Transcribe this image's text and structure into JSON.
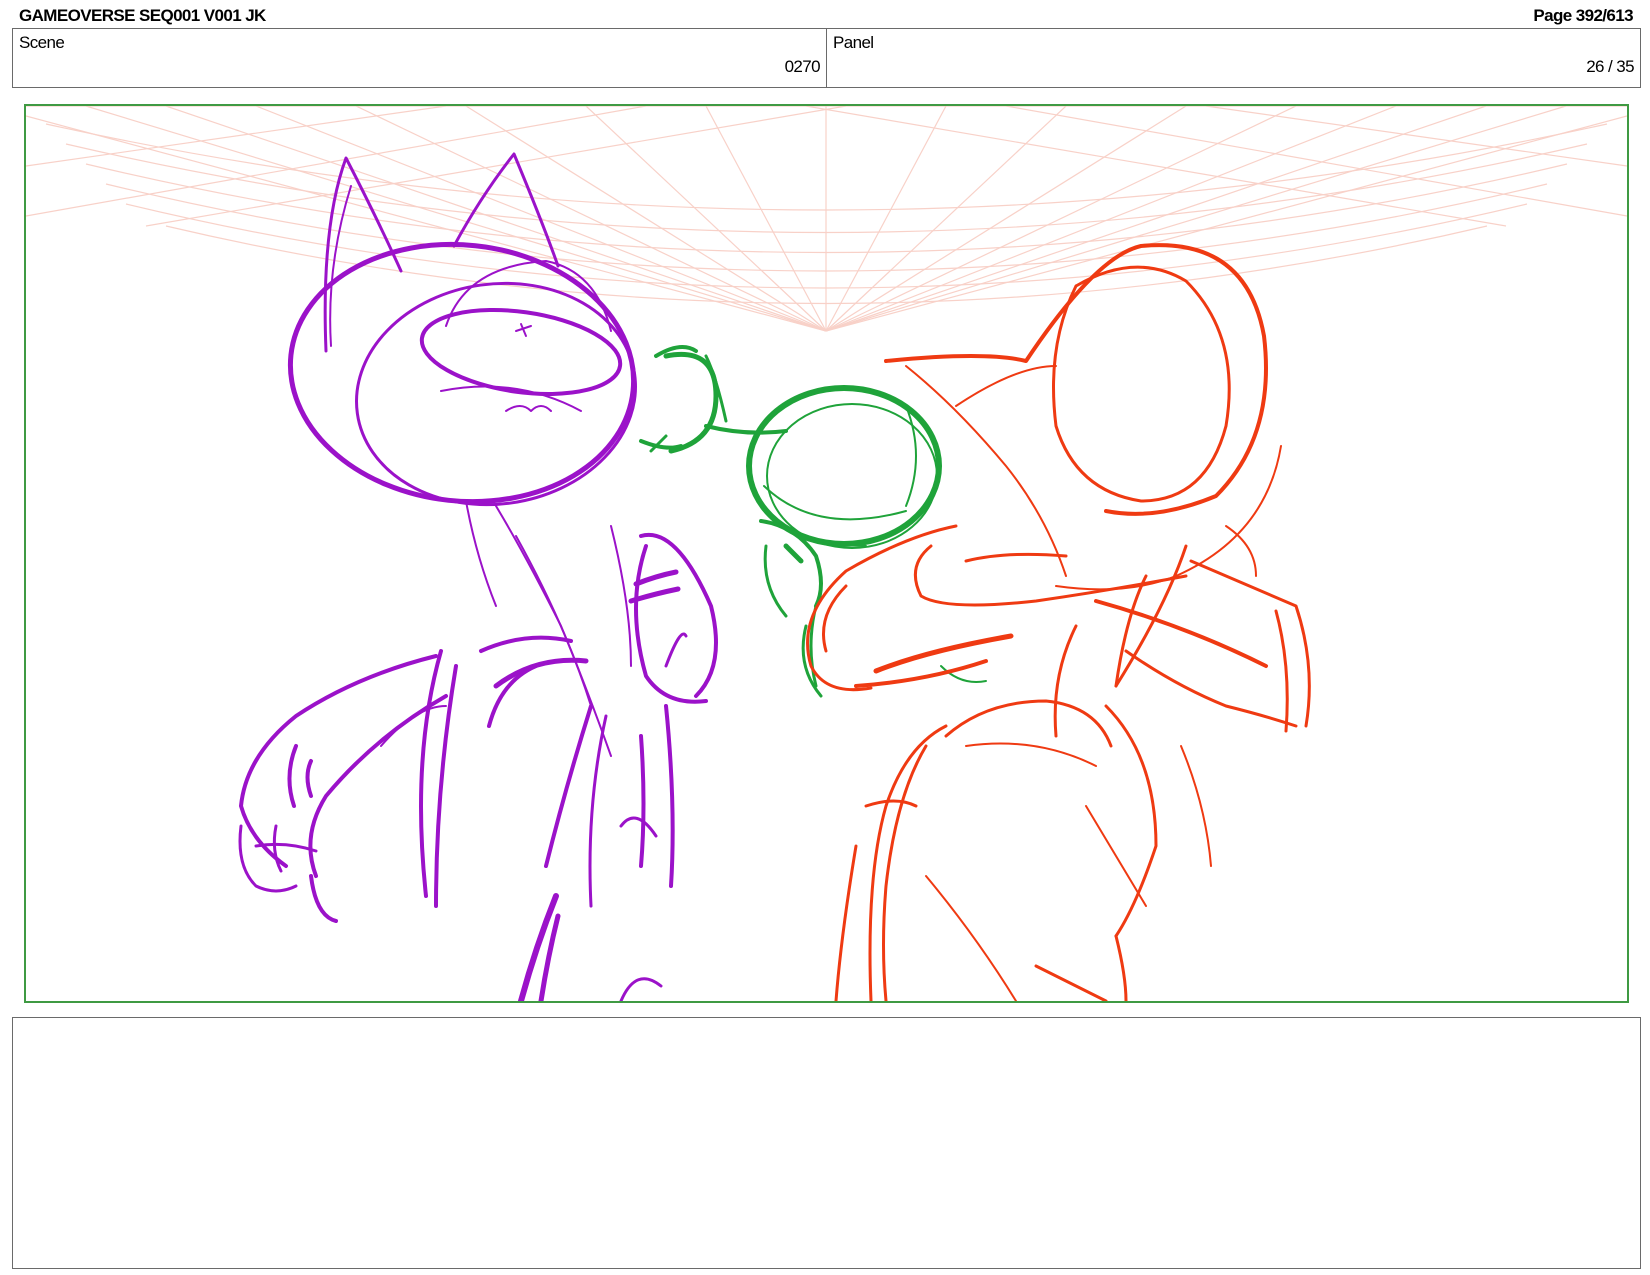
{
  "header": {
    "title": "GAMEOVERSE SEQ001 V001 JK",
    "page": "Page 392/613"
  },
  "info": {
    "scene_label": "Scene",
    "scene_value": "0270",
    "panel_label": "Panel",
    "panel_value": "26 / 35"
  },
  "panel_image": {
    "frame_color": "#3f9a43",
    "colors": {
      "cat_character": "#9b12c9",
      "robot_character": "#1fa33a",
      "red_character": "#ef3a12",
      "background_grid": "#f7c9bf"
    }
  },
  "notes": {
    "text": ""
  }
}
